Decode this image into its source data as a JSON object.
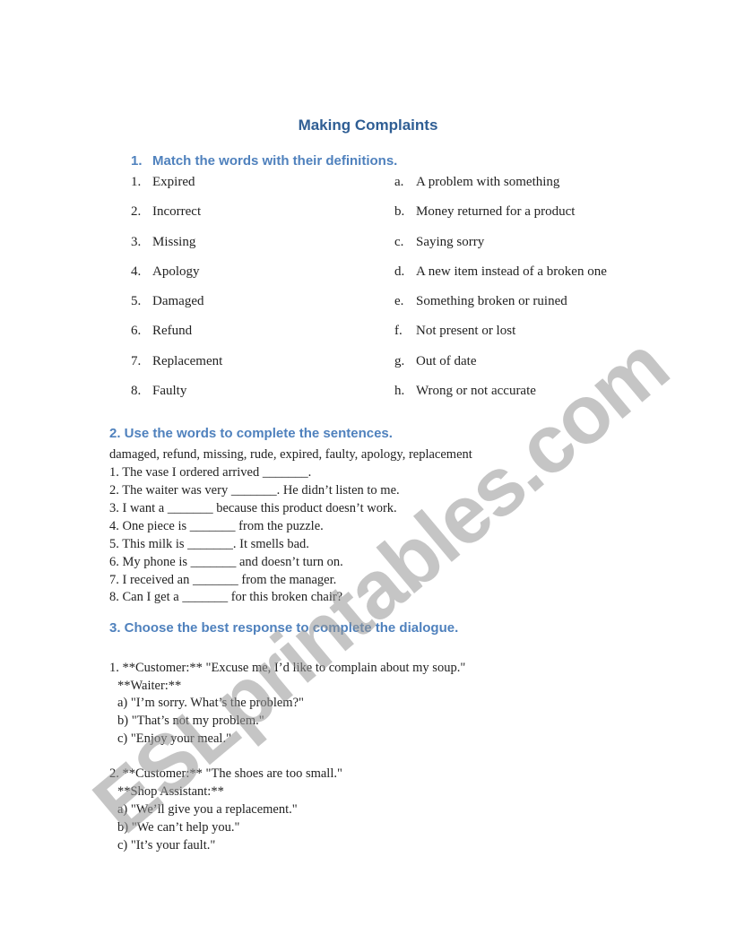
{
  "title": "Making Complaints",
  "section1": {
    "number": "1.",
    "heading": "Match the words with their definitions.",
    "words": [
      {
        "n": "1.",
        "text": "Expired"
      },
      {
        "n": "2.",
        "text": "Incorrect"
      },
      {
        "n": "3.",
        "text": "Missing"
      },
      {
        "n": "4.",
        "text": "Apology"
      },
      {
        "n": "5.",
        "text": "Damaged"
      },
      {
        "n": "6.",
        "text": "Refund"
      },
      {
        "n": "7.",
        "text": "Replacement"
      },
      {
        "n": "8.",
        "text": "Faulty"
      }
    ],
    "definitions": [
      {
        "n": "a.",
        "text": "A problem with something"
      },
      {
        "n": "b.",
        "text": "Money returned for a product"
      },
      {
        "n": "c.",
        "text": "Saying sorry"
      },
      {
        "n": "d.",
        "text": "A new item instead of a broken one"
      },
      {
        "n": "e.",
        "text": "Something broken or ruined"
      },
      {
        "n": "f.",
        "text": "Not present or lost"
      },
      {
        "n": "g.",
        "text": "Out of date"
      },
      {
        "n": "h.",
        "text": "Wrong or not accurate"
      }
    ]
  },
  "section2": {
    "heading": "2. Use the words to complete the sentences.",
    "word_bank": "damaged, refund, missing, rude, expired, faulty, apology, replacement",
    "sentences": [
      "1. The vase I ordered arrived _______.",
      "2. The waiter was very _______. He didn’t listen to me.",
      "3. I want a _______ because this product doesn’t work.",
      "4. One piece is _______ from the puzzle.",
      "5. This milk is _______. It smells bad.",
      "6. My phone is _______ and doesn’t turn on.",
      "7. I received an _______ from the manager.",
      "8. Can I get a _______ for this broken chair?"
    ]
  },
  "section3": {
    "heading": "3. Choose the best response to complete the dialogue.",
    "dialogues": [
      {
        "prompt": "1. **Customer:** \"Excuse me, I’d like to complain about my soup.\"",
        "speaker": "**Waiter:**",
        "options": [
          "a) \"I’m sorry. What’s the problem?\"",
          "b) \"That’s not my problem.\"",
          "c) \"Enjoy your meal.\""
        ]
      },
      {
        "prompt": "2. **Customer:** \"The shoes are too small.\"",
        "speaker": "**Shop Assistant:**",
        "options": [
          "a) \"We’ll give you a replacement.\"",
          "b) \"We can’t help you.\"",
          "c) \"It’s your fault.\""
        ]
      }
    ]
  },
  "watermark": "ESLprintables.com",
  "colors": {
    "title": "#2f5e94",
    "heading": "#4f81bd",
    "watermark": "#969696"
  }
}
